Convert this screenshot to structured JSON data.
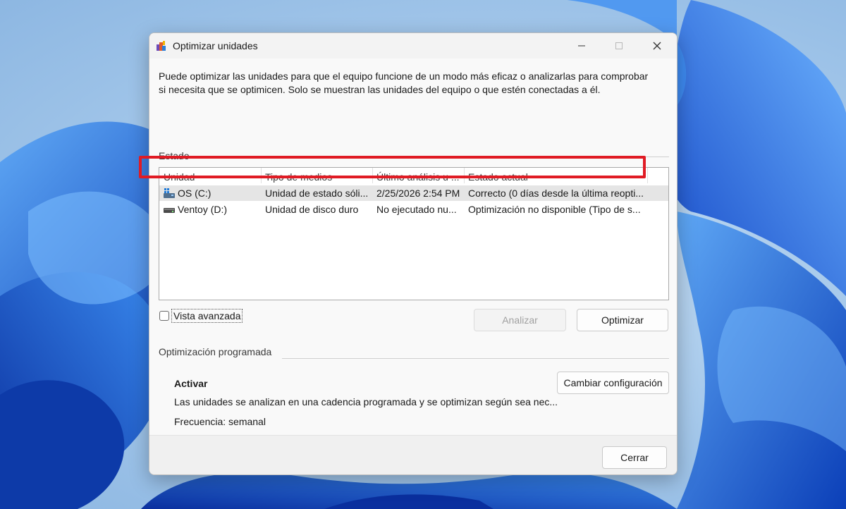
{
  "window": {
    "title": "Optimizar unidades",
    "intro": "Puede optimizar las unidades para que el equipo funcione de un modo más eficaz o analizarlas para comprobar si necesita que se optimicen. Solo se muestran las unidades del equipo o que estén conectadas a él."
  },
  "status_group": {
    "label": "Estado",
    "columns": [
      "Unidad",
      "Tipo de medios",
      "Último análisis u ...",
      "Estado actual"
    ],
    "drives": [
      {
        "name": "OS (C:)",
        "media_type": "Unidad de estado sóli...",
        "last_run": "2/25/2026 2:54 PM",
        "status": "Correcto (0 días desde la última reopti...",
        "icon": "system-drive-icon",
        "selected": true
      },
      {
        "name": "Ventoy (D:)",
        "media_type": "Unidad de disco duro",
        "last_run": "No ejecutado nu...",
        "status": "Optimización no disponible (Tipo de s...",
        "icon": "hard-drive-icon",
        "selected": false
      }
    ]
  },
  "controls": {
    "advanced_view_label": "Vista avanzada",
    "analyze_label": "Analizar",
    "optimize_label": "Optimizar"
  },
  "schedule_group": {
    "label": "Optimización programada",
    "title": "Activar",
    "description": "Las unidades se analizan en una cadencia programada y se optimizan según sea nec...",
    "frequency": "Frecuencia: semanal",
    "change_label": "Cambiar configuración"
  },
  "footer": {
    "close_label": "Cerrar"
  },
  "colors": {
    "highlight": "#e01b24",
    "selected_row": "#e5e5e5",
    "wallpaper_blue": "#1f5fd6"
  }
}
